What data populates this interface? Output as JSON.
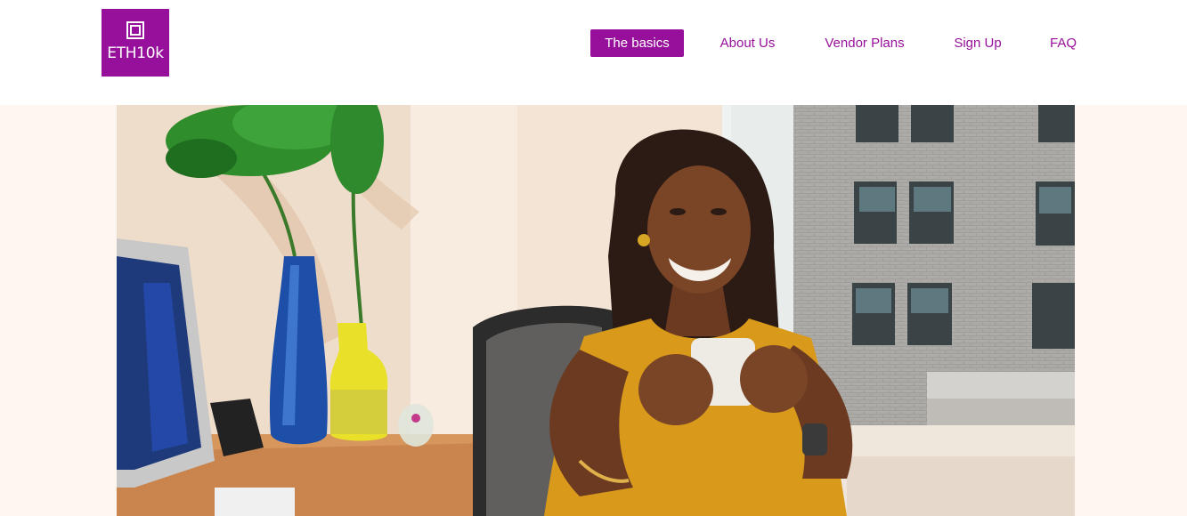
{
  "logo": {
    "text": "ETH10k",
    "background": "#97109b"
  },
  "nav": {
    "items": [
      {
        "label": "The basics",
        "active": true
      },
      {
        "label": "About Us",
        "active": false
      },
      {
        "label": "Vendor Plans",
        "active": false
      },
      {
        "label": "Sign Up",
        "active": false
      },
      {
        "label": "FAQ",
        "active": false
      }
    ],
    "accent": "#97109b"
  },
  "hero": {
    "image": "photo-woman-with-coffee-at-desk"
  }
}
